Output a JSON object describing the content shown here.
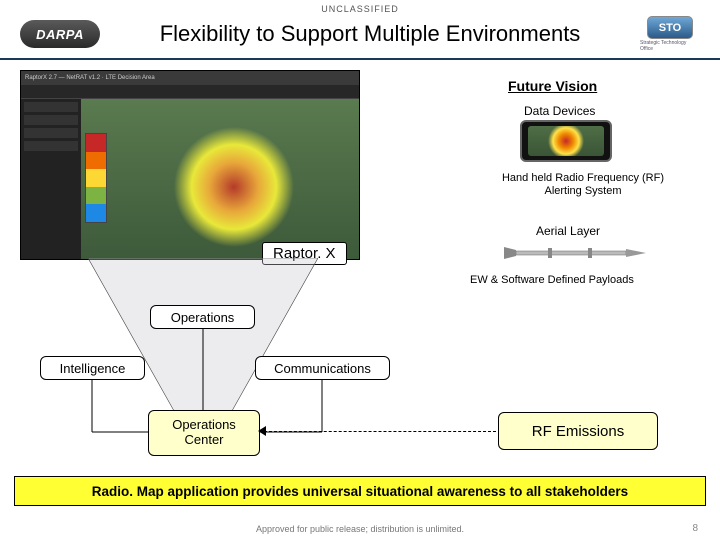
{
  "classification": "UNCLASSIFIED",
  "header": {
    "darpa": "DARPA",
    "title": "Flexibility to Support Multiple Environments",
    "sto": "STO",
    "sto_sub": "Strategic Technology Office"
  },
  "screenshot": {
    "window_title": "RaptorX 2.7 — NetRAT v1.2 · LTE Decision Area",
    "overlay_label": "Raptor. X"
  },
  "nodes": {
    "operations": "Operations",
    "intelligence": "Intelligence",
    "communications": "Communications",
    "center_line1": "Operations",
    "center_line2": "Center"
  },
  "future_vision": {
    "title": "Future Vision",
    "data_devices": "Data Devices",
    "handheld": "Hand held Radio Frequency (RF) Alerting System",
    "aerial": "Aerial Layer",
    "ew": "EW & Software Defined Payloads"
  },
  "rf_box": "RF Emissions",
  "banner": "Radio. Map application provides universal situational awareness to all stakeholders",
  "footer": "Approved for public release; distribution is unlimited.",
  "page_number": "8"
}
